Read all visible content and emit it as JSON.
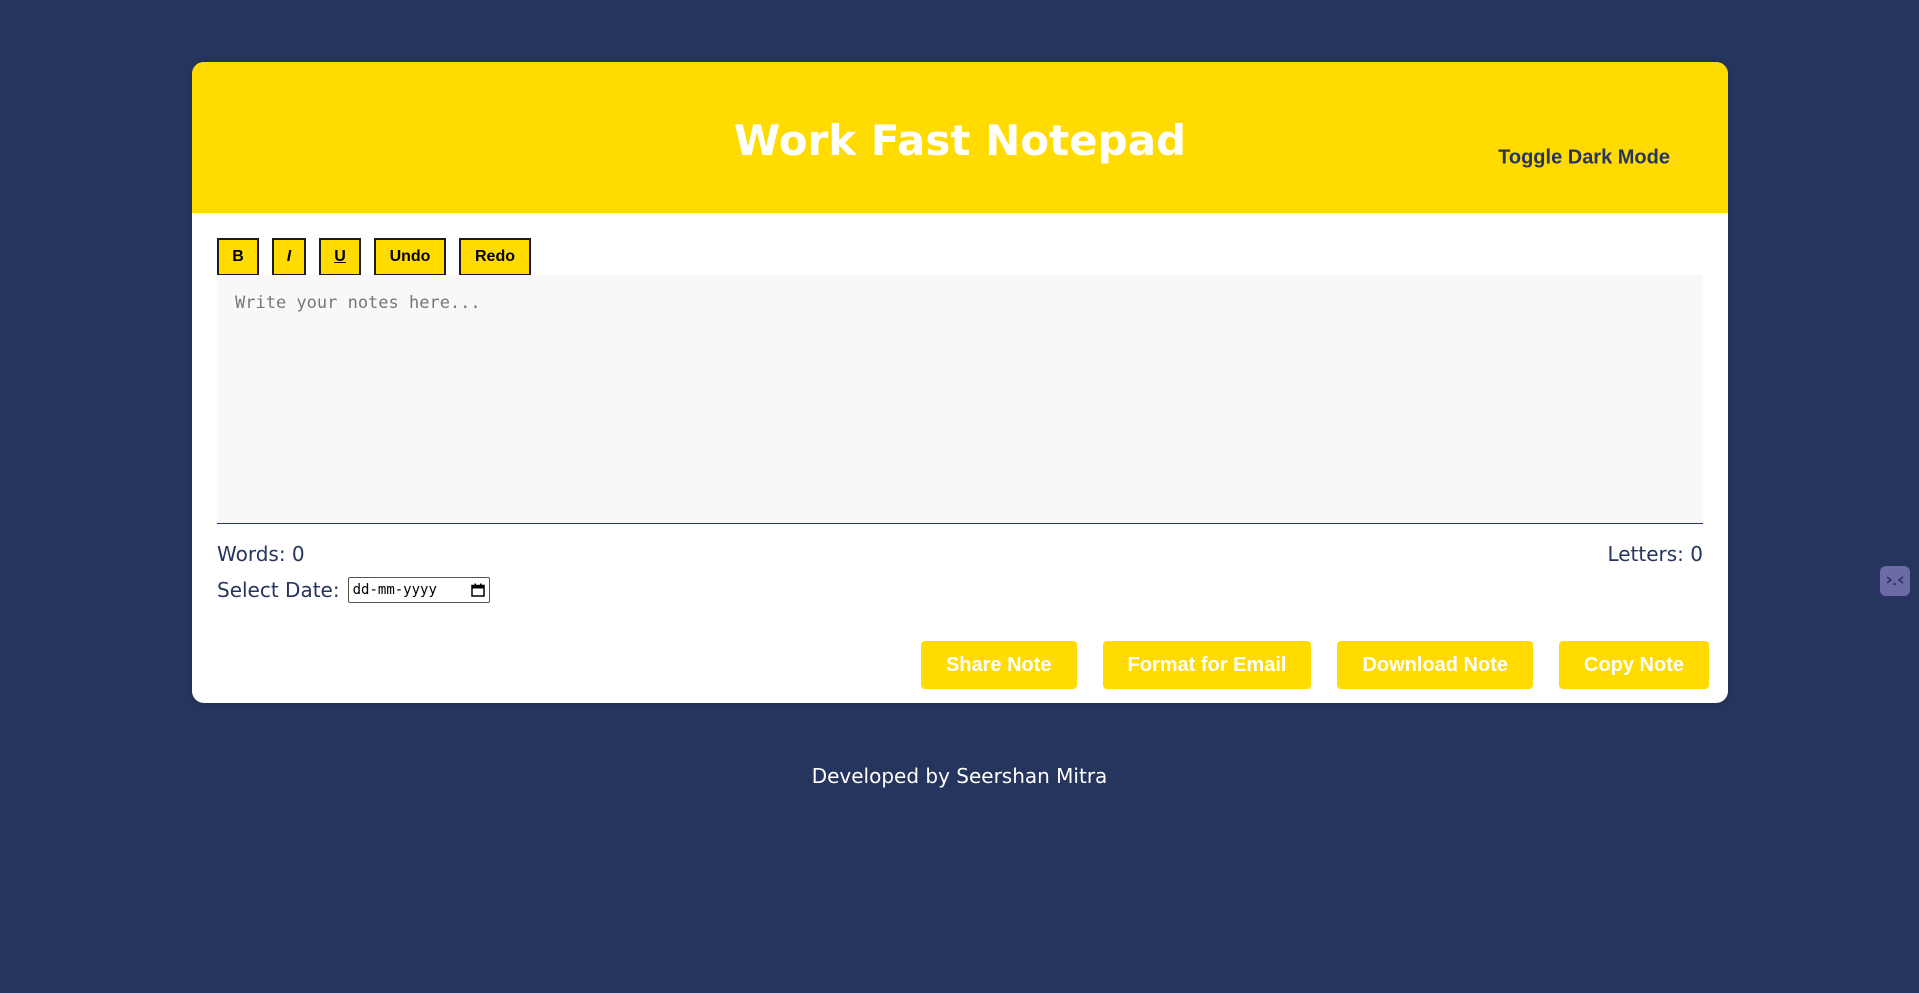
{
  "header": {
    "title": "Work Fast Notepad",
    "dark_mode_label": "Toggle Dark Mode"
  },
  "toolbar": {
    "bold_label": "B",
    "italic_label": "I",
    "underline_label": "U",
    "undo_label": "Undo",
    "redo_label": "Redo"
  },
  "editor": {
    "placeholder": "Write your notes here...",
    "value": ""
  },
  "stats": {
    "words_label": "Words: 0",
    "letters_label": "Letters: 0"
  },
  "date": {
    "label": "Select Date:",
    "placeholder": "dd-mm-yyyy"
  },
  "actions": {
    "share_label": "Share Note",
    "email_label": "Format for Email",
    "download_label": "Download Note",
    "copy_label": "Copy Note"
  },
  "footer": {
    "credit": "Developed by Seershan Mitra"
  },
  "colors": {
    "background": "#26355d",
    "accent": "#ffdb00",
    "card": "#ffffff"
  }
}
